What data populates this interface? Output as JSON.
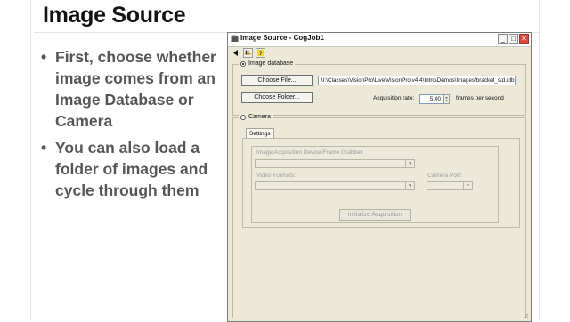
{
  "slide": {
    "title": "Image Source",
    "bullets": [
      "First, choose whether image comes from an Image Database or Camera",
      "You can also load a folder of images and cycle through them"
    ]
  },
  "window": {
    "title": "Image Source - CogJob1",
    "minimize": "_",
    "maximize": "□",
    "close": "✕",
    "toolbar_icons": [
      "play-icon",
      "tree-icon",
      "help-icon"
    ]
  },
  "image_database": {
    "label": "Image database",
    "selected": true,
    "choose_file_label": "Choose File...",
    "file_path": "U:\\Classes\\VisionPro\\Live\\VisionPro v4.4\\Intro\\Demos\\Images\\bracket_std.idb",
    "choose_folder_label": "Choose Folder...",
    "acq_rate_label": "Acquisition rate:",
    "acq_rate_value": "5.00",
    "acq_rate_units": "frames per second"
  },
  "camera": {
    "label": "Camera",
    "selected": false,
    "tab_label": "Settings",
    "device_label": "Image Acquisition Device/Frame Grabber:",
    "video_formats_label": "Video Formats:",
    "camera_port_label": "Camera Port:",
    "init_button_label": "Initialize Acquisition"
  }
}
